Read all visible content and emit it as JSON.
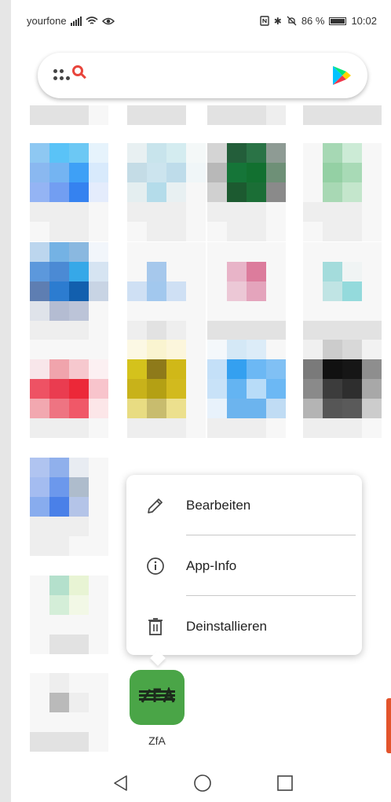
{
  "status_bar": {
    "carrier": "yourfone",
    "battery_percent": "86 %",
    "time": "10:02",
    "icons": [
      "signal-icon",
      "wifi-icon",
      "eye-icon",
      "nfc-icon",
      "bluetooth-icon",
      "mute-icon",
      "battery-icon"
    ]
  },
  "search_bar": {
    "icons": [
      "app-drawer-dots-icon",
      "search-icon",
      "play-store-icon"
    ]
  },
  "context_menu": {
    "items": [
      {
        "label": "Bearbeiten",
        "icon": "pencil-icon"
      },
      {
        "label": "App-Info",
        "icon": "info-icon"
      },
      {
        "label": "Deinstallieren",
        "icon": "trash-icon"
      }
    ]
  },
  "selected_app": {
    "label": "ZfA",
    "icon_color": "#4aa547",
    "logo_text": "ZfA"
  },
  "nav_bar": {
    "buttons": [
      "back-icon",
      "home-icon",
      "recents-icon"
    ]
  },
  "colors": {
    "accent_red": "#e8453c",
    "app_green": "#4aa547"
  }
}
